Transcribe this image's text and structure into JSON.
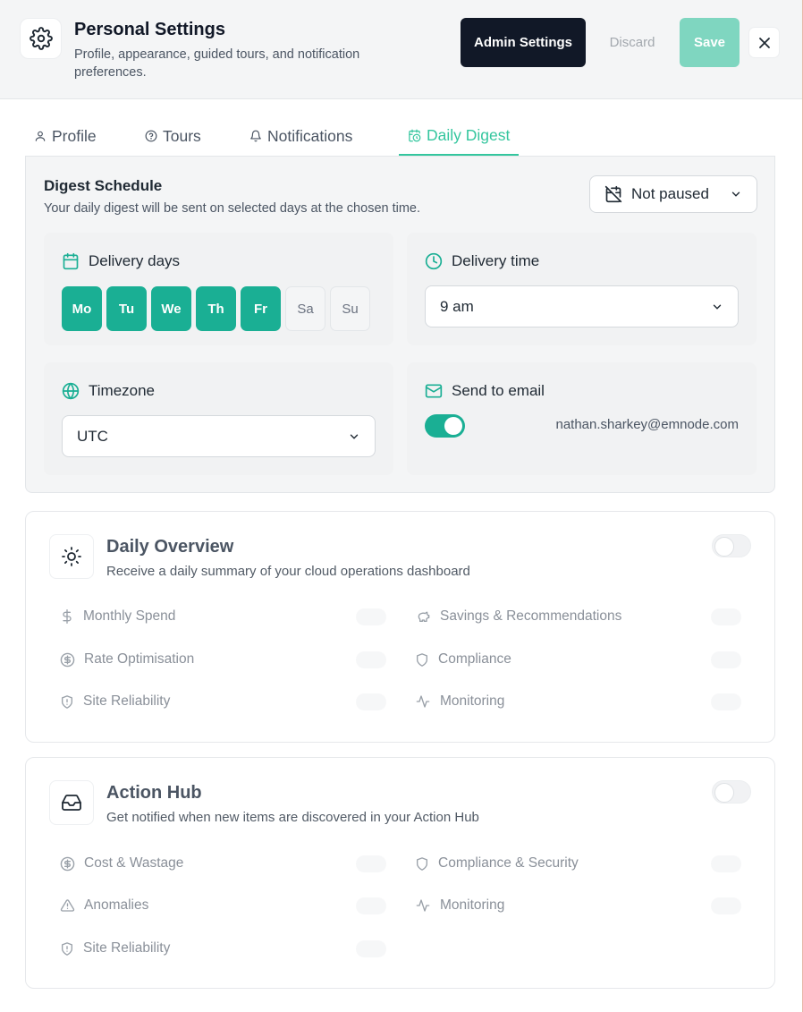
{
  "header": {
    "title": "Personal Settings",
    "subtitle": "Profile, appearance, guided tours, and notification preferences.",
    "settings_icon": "gear-icon",
    "admin_label": "Admin Settings",
    "discard_label": "Discard",
    "save_label": "Save",
    "close_icon": "close-icon"
  },
  "tabs": [
    {
      "label": "Profile",
      "icon": "user-icon"
    },
    {
      "label": "Tours",
      "icon": "help-circle-icon"
    },
    {
      "label": "Notifications",
      "icon": "bell-icon"
    },
    {
      "label": "Daily Digest",
      "icon": "calendar-clock-icon",
      "active": true
    }
  ],
  "schedule": {
    "title": "Digest Schedule",
    "subtitle": "Your daily digest will be sent on selected days at the chosen time.",
    "pause_value": "Not paused",
    "delivery_days": {
      "label": "Delivery days",
      "days": [
        {
          "label": "Mo",
          "selected": true
        },
        {
          "label": "Tu",
          "selected": true
        },
        {
          "label": "We",
          "selected": true
        },
        {
          "label": "Th",
          "selected": true
        },
        {
          "label": "Fr",
          "selected": true
        },
        {
          "label": "Sa",
          "selected": false
        },
        {
          "label": "Su",
          "selected": false
        }
      ]
    },
    "delivery_time": {
      "label": "Delivery time",
      "value": "9 am"
    },
    "timezone": {
      "label": "Timezone",
      "value": "UTC"
    },
    "send_email": {
      "label": "Send to email",
      "enabled": true,
      "email": "nathan.sharkey@emnode.com"
    }
  },
  "daily_overview": {
    "title": "Daily Overview",
    "subtitle": "Receive a daily summary of your cloud operations dashboard",
    "enabled": false,
    "options": [
      {
        "label": "Monthly Spend",
        "icon": "dollar-icon"
      },
      {
        "label": "Savings & Recommendations",
        "icon": "piggy-bank-icon"
      },
      {
        "label": "Rate Optimisation",
        "icon": "circle-dollar-icon"
      },
      {
        "label": "Compliance",
        "icon": "shield-icon"
      },
      {
        "label": "Site Reliability",
        "icon": "shield-alert-icon"
      },
      {
        "label": "Monitoring",
        "icon": "activity-icon"
      }
    ]
  },
  "action_hub": {
    "title": "Action Hub",
    "subtitle": "Get notified when new items are discovered in your Action Hub",
    "enabled": false,
    "options": [
      {
        "label": "Cost & Wastage",
        "icon": "circle-dollar-icon"
      },
      {
        "label": "Compliance & Security",
        "icon": "shield-icon"
      },
      {
        "label": "Anomalies",
        "icon": "warning-icon"
      },
      {
        "label": "Monitoring",
        "icon": "activity-icon"
      },
      {
        "label": "Site Reliability",
        "icon": "shield-alert-icon"
      }
    ]
  },
  "colors": {
    "accent": "#1aaf94",
    "accent_light": "#7fd6c0",
    "dark": "#111827"
  }
}
